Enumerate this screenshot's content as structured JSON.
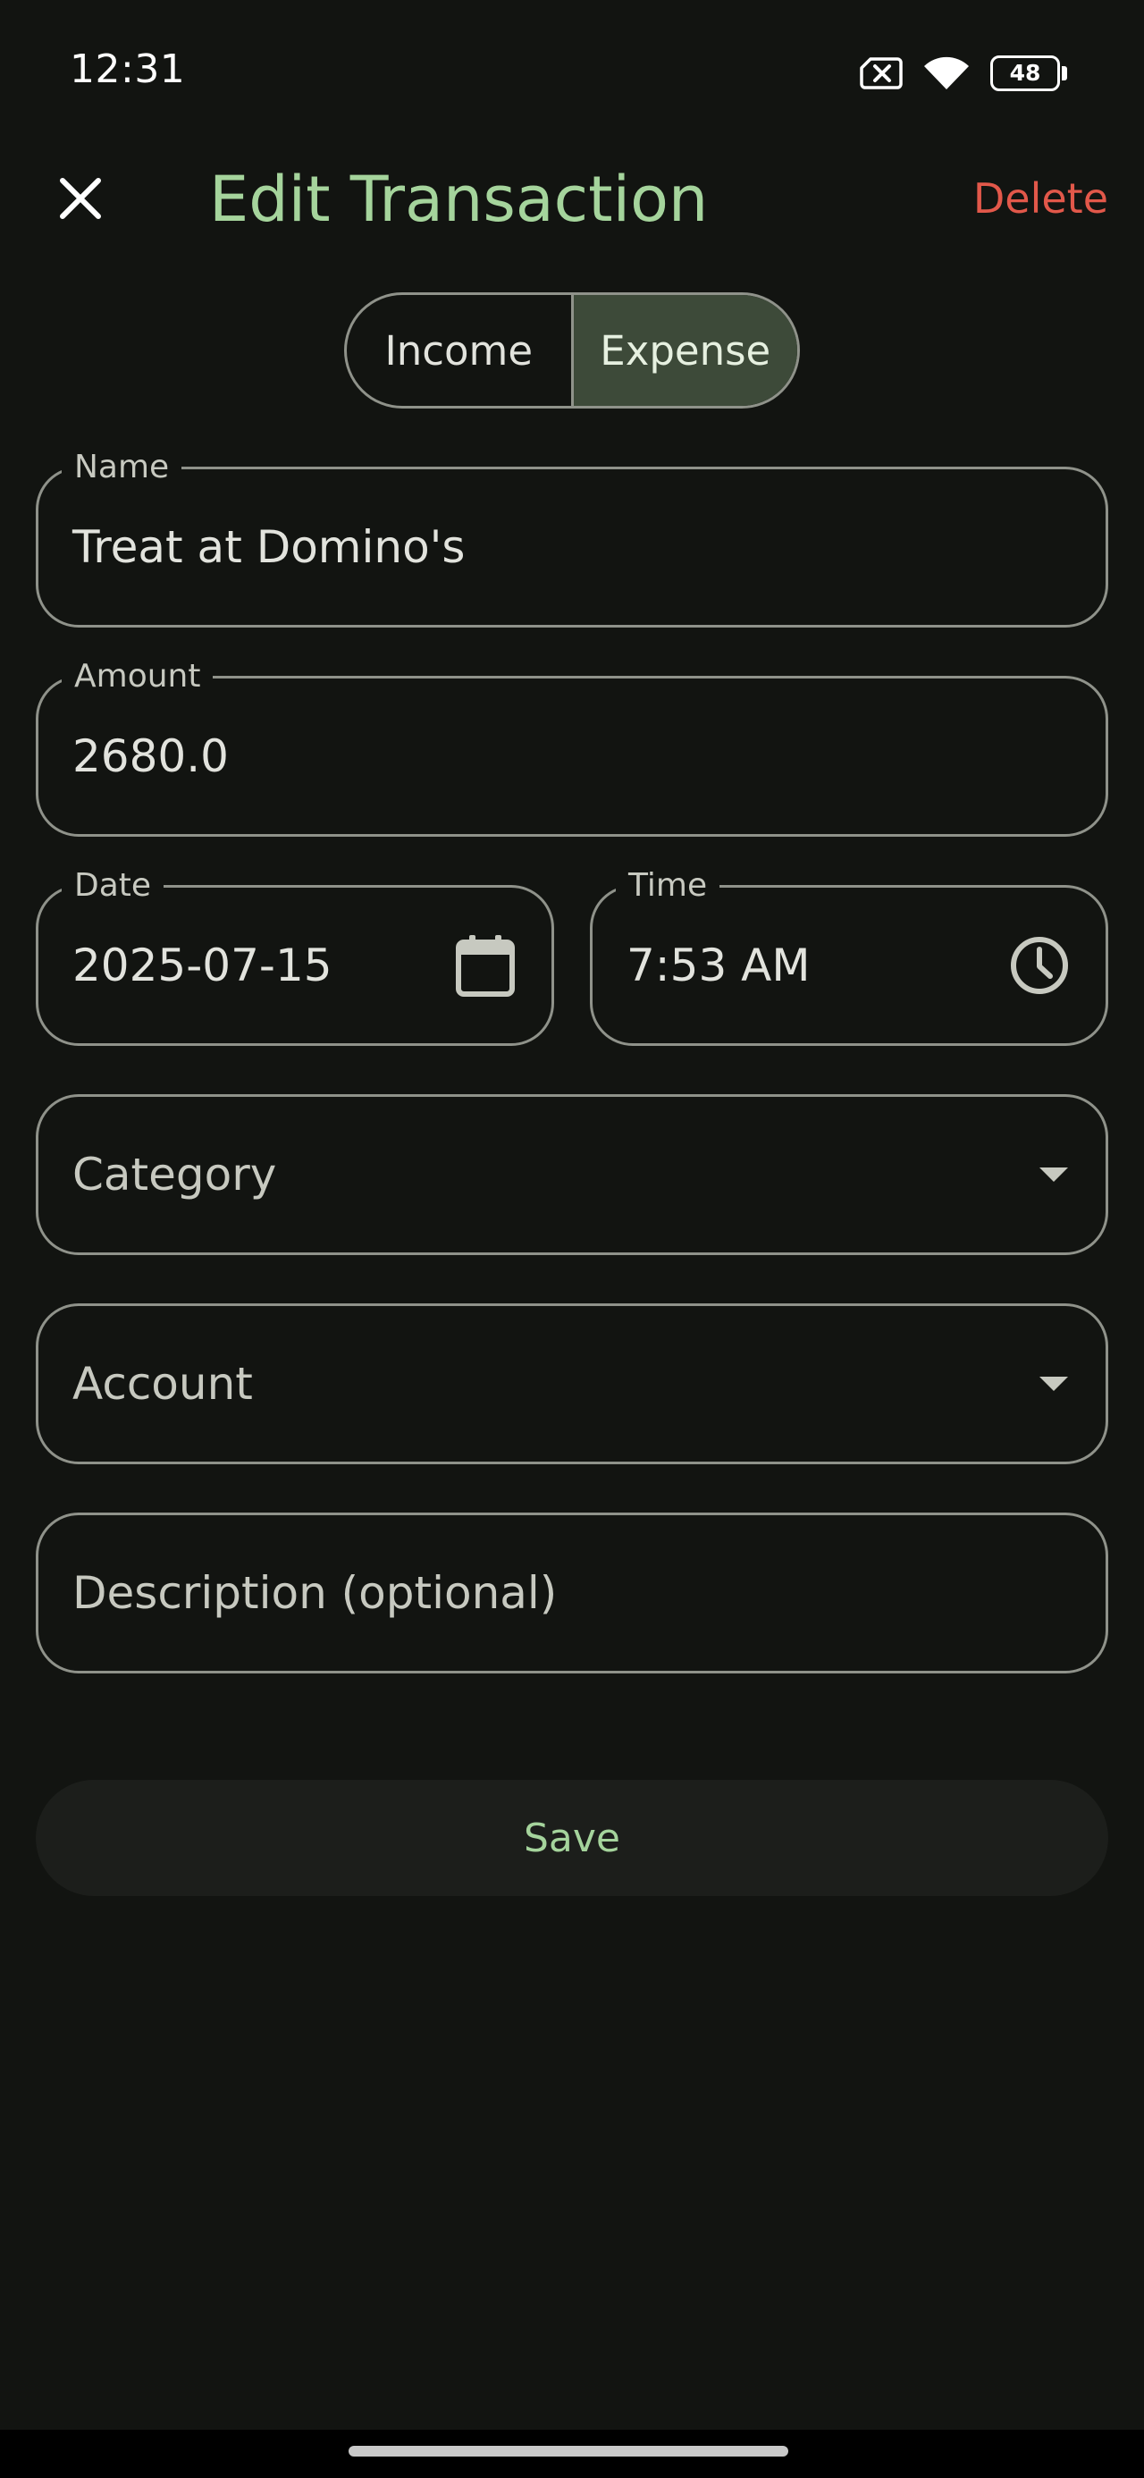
{
  "status_bar": {
    "time": "12:31",
    "battery": "48",
    "icons": [
      "no-sim-icon",
      "wifi-icon",
      "battery-icon"
    ]
  },
  "app_bar": {
    "close_icon": "close-icon",
    "title": "Edit Transaction",
    "delete_label": "Delete"
  },
  "type_toggle": {
    "income_label": "Income",
    "expense_label": "Expense",
    "selected": "Expense"
  },
  "form": {
    "name": {
      "label": "Name",
      "value": "Treat at Domino's"
    },
    "amount": {
      "label": "Amount",
      "value": "2680.0"
    },
    "date": {
      "label": "Date",
      "value": "2025-07-15",
      "icon": "calendar-icon"
    },
    "time": {
      "label": "Time",
      "value": "7:53 AM",
      "icon": "clock-icon"
    },
    "category": {
      "placeholder": "Category",
      "icon": "dropdown-arrow-icon"
    },
    "account": {
      "placeholder": "Account",
      "icon": "dropdown-arrow-icon"
    },
    "description": {
      "placeholder": "Description (optional)"
    }
  },
  "save_label": "Save",
  "colors": {
    "background": "#121411",
    "accent": "#a5d49c",
    "danger": "#e2584a",
    "outline": "#8f928a",
    "selected_segment": "#3d4a39"
  }
}
